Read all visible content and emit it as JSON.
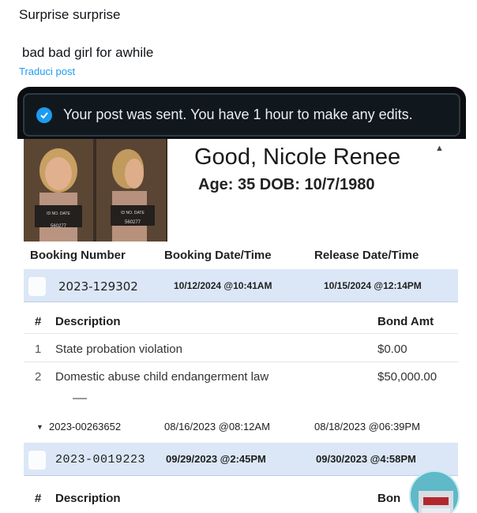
{
  "post": {
    "line1": "Surprise surprise",
    "line2": "bad bad girl for awhile",
    "translate": "Traduci post"
  },
  "banner": {
    "text": "Your post was sent. You have 1 hour to make any edits.",
    "icon": "check-circle-icon"
  },
  "record": {
    "name": "Good, Nicole Renee",
    "age_dob": "Age: 35   DOB: 10/7/1980",
    "photo_ids": [
      "560277",
      "560277"
    ]
  },
  "booking_headers": [
    "Booking Number",
    "Booking Date/Time",
    "Release Date/Time"
  ],
  "bookings": [
    {
      "number": "2023-129302",
      "date": "10/12/2024 @10:41AM",
      "release": "10/15/2024 @12:14PM"
    },
    {
      "number": "2023-00263652",
      "date": "08/16/2023 @08:12AM",
      "release": "08/18/2023 @06:39PM"
    },
    {
      "number": "2023-0019223",
      "date": "09/29/2023 @2:45PM",
      "release": "09/30/2023 @4:58PM"
    }
  ],
  "charges_headers": {
    "hash": "#",
    "description": "Description",
    "bond": "Bond Amt",
    "bond_partial": "Bon"
  },
  "charges": [
    {
      "n": "1",
      "description": "State probation violation",
      "bond": "$0.00"
    },
    {
      "n": "2",
      "description": "Domestic abuse child endangerment law",
      "bond": "$50,000.00"
    }
  ],
  "colors": {
    "link": "#1d9bf0",
    "banner_bg": "#11181d",
    "row_blue": "#dbe7f6"
  }
}
